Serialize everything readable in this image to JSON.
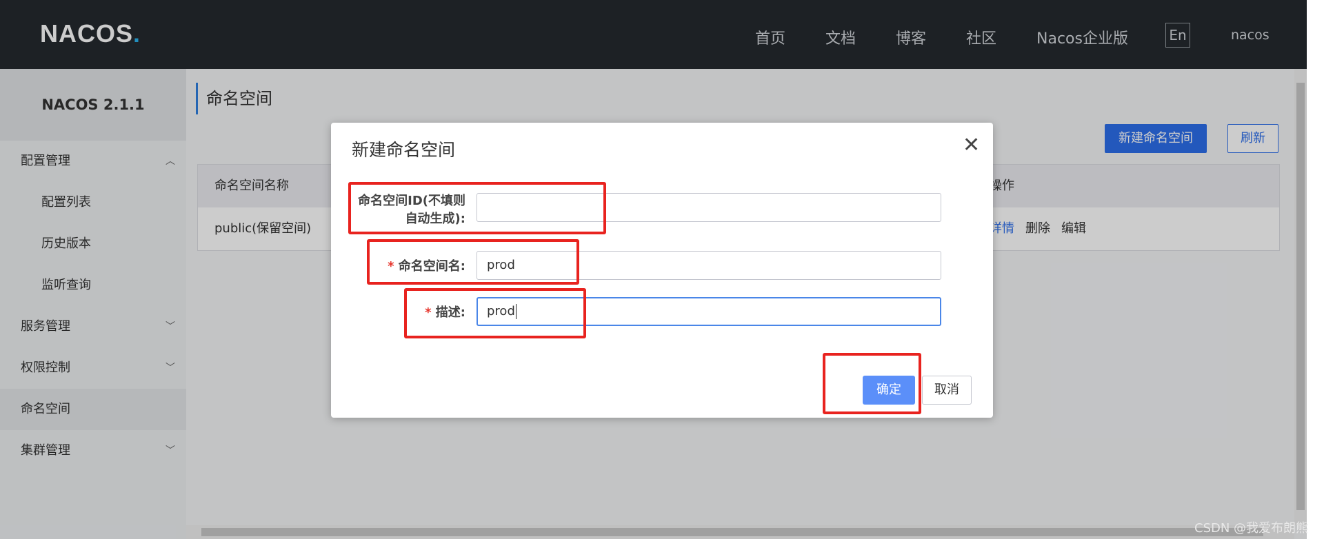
{
  "header": {
    "logo_part1": "NA",
    "logo_part2": "COS",
    "logo_dot": ".",
    "nav": [
      "首页",
      "文档",
      "博客",
      "社区",
      "Nacos企业版"
    ],
    "lang": "En",
    "user": "nacos"
  },
  "sidebar": {
    "version": "NACOS 2.1.1",
    "items": [
      {
        "label": "配置管理",
        "icon": "chevron-up-icon"
      },
      {
        "label": "配置列表"
      },
      {
        "label": "历史版本"
      },
      {
        "label": "监听查询"
      },
      {
        "label": "服务管理",
        "icon": "chevron-down-icon"
      },
      {
        "label": "权限控制",
        "icon": "chevron-down-icon"
      },
      {
        "label": "命名空间"
      },
      {
        "label": "集群管理",
        "icon": "chevron-down-icon"
      }
    ]
  },
  "main": {
    "title": "命名空间",
    "create_button": "新建命名空间",
    "refresh_button": "刷新",
    "table": {
      "headers": [
        "命名空间名称",
        "操作"
      ],
      "rows": [
        {
          "name": "public(保留空间)",
          "actions": [
            "详情",
            "删除",
            "编辑"
          ]
        }
      ]
    }
  },
  "dialog": {
    "title": "新建命名空间",
    "id_label_line1": "命名空间ID(不填则",
    "id_label_line2": "自动生成):",
    "id_value": "",
    "name_label": "命名空间名:",
    "name_value": "prod",
    "desc_label": "描述:",
    "desc_value": "prod",
    "required_mark": "*",
    "ok_button": "确定",
    "cancel_button": "取消",
    "close_icon": "close-icon"
  },
  "watermark": "CSDN @我爱布朗熊",
  "colors": {
    "header_bg": "#252a2f",
    "primary": "#2c6eeb",
    "highlight_red": "#e8231f"
  }
}
